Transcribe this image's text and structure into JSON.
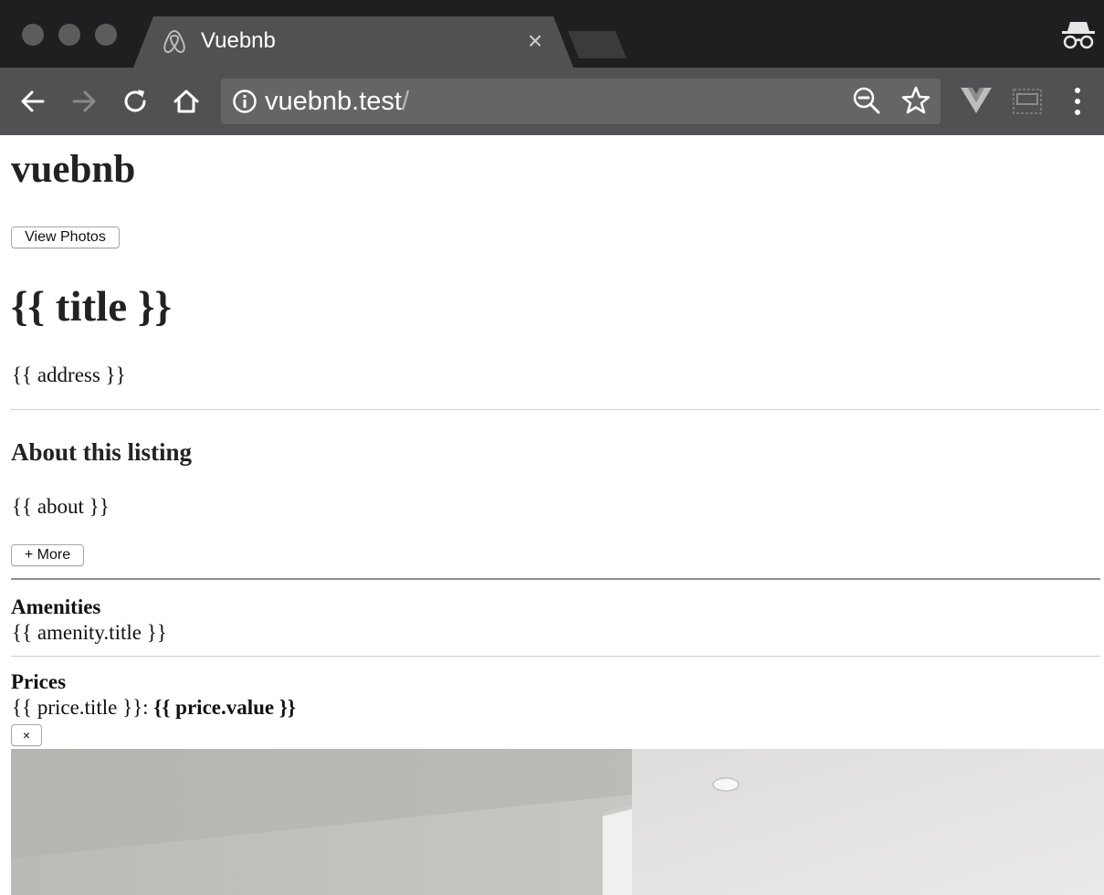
{
  "browser": {
    "tab_title": "Vuebnb",
    "tab_close": "×",
    "url_host": "vuebnb.test",
    "url_path": "/"
  },
  "page": {
    "site_title": "vuebnb",
    "view_photos_button": "View Photos",
    "listing_title": "{{ title }}",
    "address": "{{ address }}",
    "about_heading": "About this listing",
    "about_text": "{{ about }}",
    "more_button": "+ More",
    "amenities_heading": "Amenities",
    "amenity_item": "{{ amenity.title }}",
    "prices_heading": "Prices",
    "price_title": "{{ price.title }}:",
    "price_value": "{{ price.value }}",
    "close_button": "×"
  }
}
